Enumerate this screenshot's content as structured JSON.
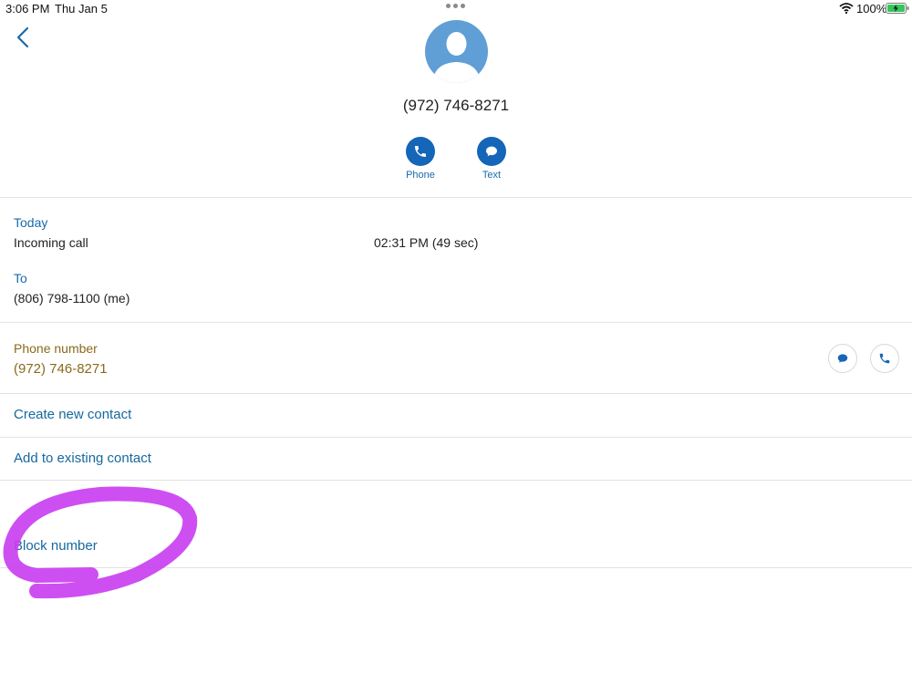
{
  "status_bar": {
    "time": "3:06 PM",
    "date": "Thu Jan 5",
    "battery": "100%"
  },
  "header": {
    "number": "(972) 746-8271",
    "actions": [
      {
        "label": "Phone"
      },
      {
        "label": "Text"
      }
    ]
  },
  "call_log": {
    "day": "Today",
    "type": "Incoming call",
    "time": "02:31 PM (49 sec)",
    "to_label": "To",
    "to_value": "(806) 798-1100 (me)"
  },
  "phone": {
    "label": "Phone number",
    "value": "(972) 746-8271"
  },
  "options": {
    "create_new": "Create new contact",
    "add_existing": "Add to existing contact",
    "block": "Block number"
  },
  "colors": {
    "accent": "#1565b8",
    "link": "#16689e",
    "gold": "#8a6a1c",
    "highlight": "#c93cf0"
  }
}
